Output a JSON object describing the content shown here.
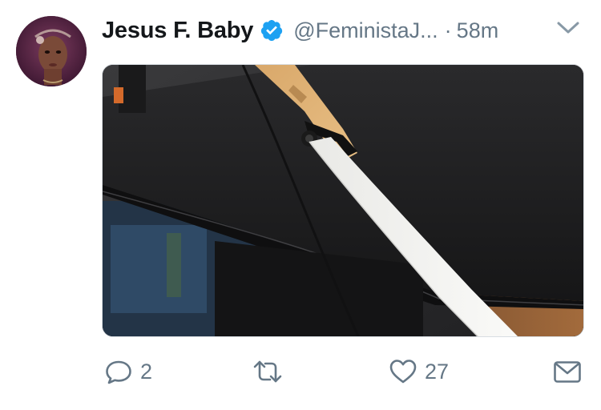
{
  "tweet": {
    "author": {
      "display_name": "Jesus F. Baby",
      "handle": "@FeministaJ...",
      "verified": true,
      "verified_icon": "verified-badge-icon"
    },
    "separator": "·",
    "timestamp": "58m",
    "menu_icon": "chevron-down-icon",
    "media": {
      "type": "photo"
    },
    "actions": {
      "reply": {
        "icon": "reply-bubble-icon",
        "count": "2"
      },
      "retweet": {
        "icon": "retweet-icon",
        "count": ""
      },
      "like": {
        "icon": "heart-icon",
        "count": "27"
      },
      "message": {
        "icon": "envelope-icon"
      }
    }
  },
  "colors": {
    "text_primary": "#14171a",
    "text_secondary": "#657786",
    "verified_blue": "#1da1f2"
  }
}
